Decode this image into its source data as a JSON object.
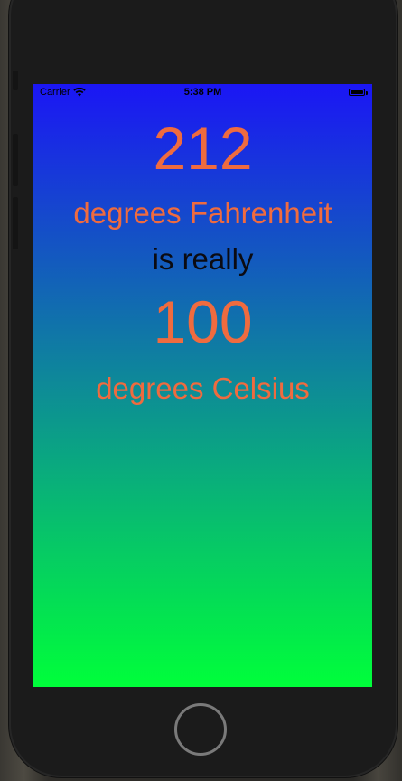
{
  "status_bar": {
    "carrier": "Carrier",
    "time": "5:38 PM",
    "battery_level": 1.0
  },
  "conversion": {
    "fahrenheit_value": "212",
    "fahrenheit_label": "degrees Fahrenheit",
    "connector": "is really",
    "celsius_value": "100",
    "celsius_label": "degrees Celsius"
  },
  "colors": {
    "value_text": "#EF6B3F",
    "connector_text": "#0B0B12",
    "gradient_top": "#1B16F5",
    "gradient_bottom": "#00FF3A",
    "status_text": "#000000"
  },
  "icons": {
    "wifi": "wifi-icon",
    "battery": "battery-icon",
    "home": "home-button"
  }
}
